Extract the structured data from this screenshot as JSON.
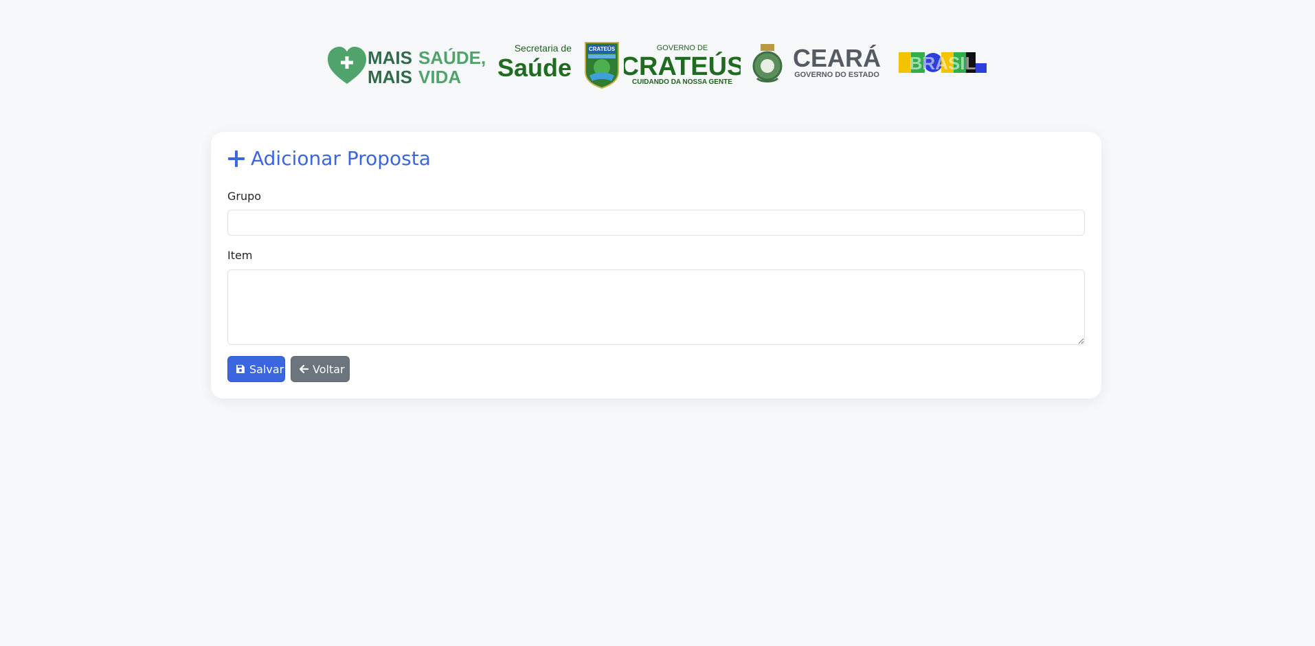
{
  "logos": {
    "mais_saude": {
      "line1_a": "MAIS",
      "line1_b": "SAÚDE,",
      "line2_a": "MAIS",
      "line2_b": "VIDA"
    },
    "secretaria": {
      "top": "Secretaria de",
      "main": "Saúde"
    },
    "crateus": {
      "crest_label": "CRATEÚS",
      "top": "GOVERNO DE",
      "main": "CRATEÚS",
      "bottom": "CUIDANDO DA NOSSA GENTE"
    },
    "ceara": {
      "main": "CEARÁ",
      "sub": "GOVERNO DO ESTADO"
    },
    "brasil": {
      "main": "BRASIL"
    }
  },
  "form": {
    "title": "Adicionar Proposta",
    "title_icon": "plus-icon",
    "grupo_label": "Grupo",
    "grupo_value": "",
    "grupo_placeholder": "",
    "item_label": "Item",
    "item_value": "",
    "item_placeholder": "",
    "save_label": "Salvar",
    "save_icon": "floppy-disk-icon",
    "back_label": "Voltar",
    "back_icon": "arrow-left-icon"
  },
  "colors": {
    "primary": "#3b66e0",
    "secondary": "#6c757d",
    "background": "#f7f8fa",
    "logo_green": "#1f6b1f",
    "logo_light_green": "#4fa36b",
    "logo_gray": "#545b62"
  }
}
